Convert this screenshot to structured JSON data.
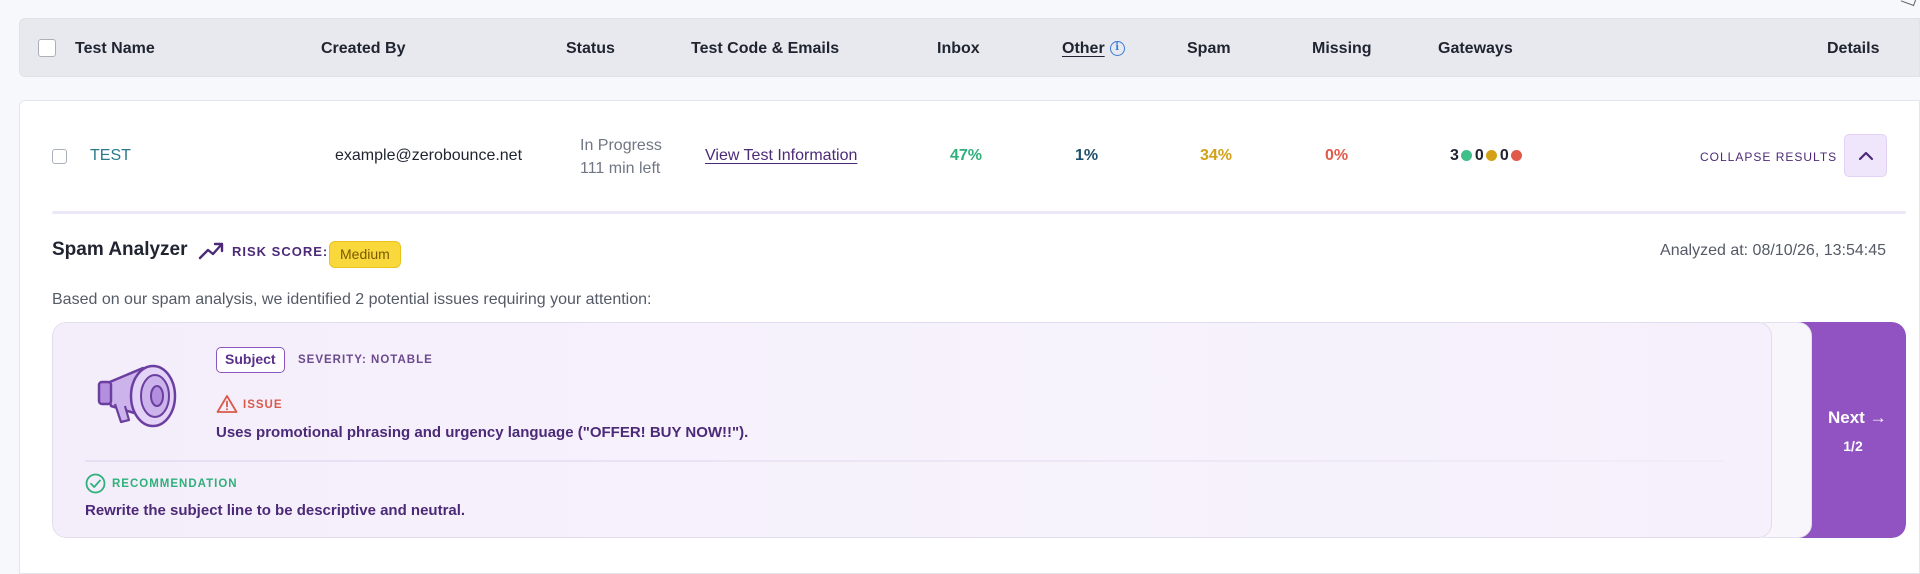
{
  "table_header": {
    "columns": [
      "Test Name",
      "Created By",
      "Status",
      "Test Code & Emails",
      "Inbox",
      "Other",
      "Spam",
      "Missing",
      "Gateways",
      "Details"
    ]
  },
  "row": {
    "test_name": "TEST",
    "created_by": "example@zerobounce.net",
    "status_line1": "In Progress",
    "status_line2": "111 min left",
    "view_link": "View Test Information",
    "inbox": "47%",
    "other": "1%",
    "spam": "34%",
    "missing": "0%",
    "gateways": {
      "green": "3",
      "yellow": "0",
      "red": "0"
    },
    "collapse_label": "COLLAPSE RESULTS"
  },
  "colors": {
    "inbox": "#2fb07a",
    "other": "#1e4f6b",
    "spam": "#d4a017",
    "missing": "#e05a4a",
    "gateway_green": "#3fbf8a",
    "gateway_yellow": "#d4a017",
    "gateway_red": "#e05a4a",
    "accent": "#9153c1"
  },
  "analyzer": {
    "title": "Spam Analyzer",
    "risk_label": "RISK SCORE:",
    "risk_value": "Medium",
    "analyzed_at": "Analyzed at: 08/10/26, 13:54:45",
    "intro": "Based on our spam analysis, we identified 2 potential issues requiring your attention:",
    "issue": {
      "category": "Subject",
      "severity": "SEVERITY: NOTABLE",
      "issue_label": "ISSUE",
      "issue_text": "Uses promotional phrasing and urgency language (\"OFFER! BUY NOW!!\").",
      "recommendation_label": "RECOMMENDATION",
      "recommendation_text": "Rewrite the subject line to be descriptive and neutral."
    },
    "next_label": "Next",
    "pager": "1/2"
  }
}
